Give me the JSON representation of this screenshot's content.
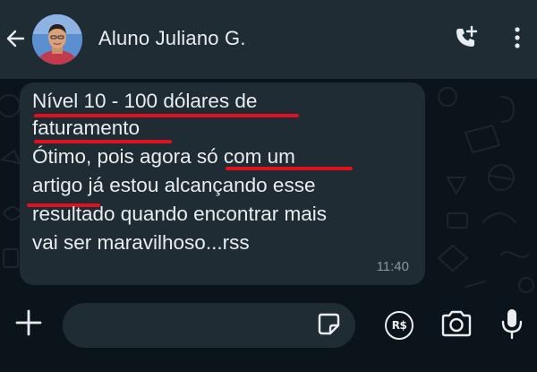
{
  "header": {
    "back_icon": "arrow-left-icon",
    "contact_name": "Aluno Juliano G.",
    "call_icon": "add-call-icon",
    "menu_icon": "more-vertical-icon"
  },
  "message": {
    "lines": [
      "Nível 10 - 100 dólares de",
      "faturamento",
      "Ótimo, pois agora só com um",
      "artigo já estou alcançando esse",
      "resultado quando encontrar mais",
      "vai ser maravilhoso...rss"
    ],
    "time": "11:40",
    "highlight_color": "#e0101f"
  },
  "footer": {
    "input_value": "",
    "input_placeholder": "",
    "plus_icon": "plus-icon",
    "sticker_icon": "sticker-icon",
    "currency_badge": "R$",
    "camera_icon": "camera-icon",
    "mic_icon": "microphone-icon"
  },
  "colors": {
    "header_bg": "#1f2c34",
    "chat_bg": "#0b141a",
    "bubble_bg": "#202c33",
    "text": "#e9edef",
    "muted": "#8696a0"
  }
}
